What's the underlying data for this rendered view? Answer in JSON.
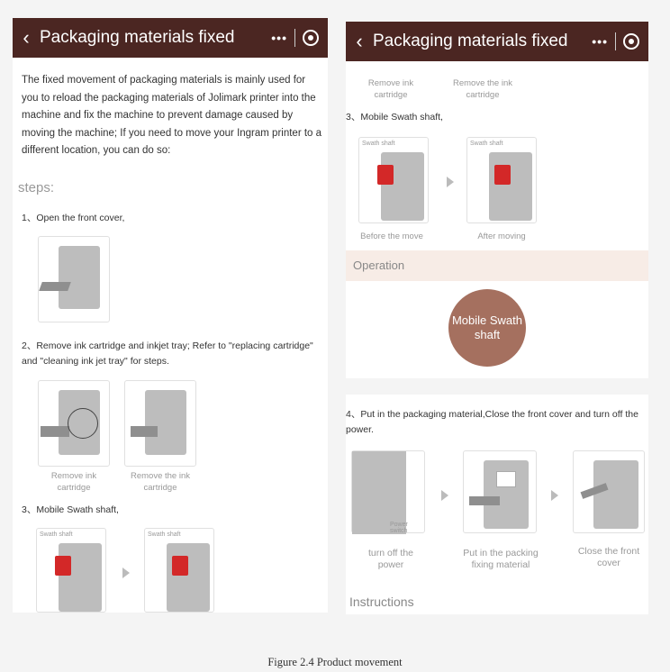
{
  "app": {
    "title": "Packaging materials fixed",
    "back_icon": "chevron-left-icon",
    "more_icon": "more-dots-icon",
    "close_icon": "target-icon"
  },
  "left": {
    "intro": "The fixed movement of packaging materials is mainly used for you to reload the packaging materials of Jolimark printer into the machine and fix the machine to prevent damage caused by moving the machine; If you need to move your Ingram printer to a different location, you can do so:",
    "steps_heading": "steps:",
    "step1": "1、Open the front cover,",
    "step2": "2、Remove ink cartridge and inkjet tray; Refer to \"replacing cartridge\" and \"cleaning ink jet tray\" for steps.",
    "step2_caption_a": "Remove ink cartridge",
    "step2_caption_b": "Remove the ink cartridge",
    "step3": "3、Mobile Swath shaft,",
    "swath_tag": "Swath shaft"
  },
  "right_top": {
    "caption_a": "Remove ink cartridge",
    "caption_b": "Remove the ink cartridge",
    "step3": "3、Mobile Swath shaft,",
    "swath_tag": "Swath shaft",
    "before": "Before the move",
    "after": "After moving",
    "operation": "Operation",
    "button": "Mobile Swath shaft"
  },
  "right_bottom": {
    "step4": "4、Put in the packaging material,Close the front cover and turn off the power.",
    "cap1": "turn off the power",
    "cap2": "Put in the packing fixing material",
    "cap3": "Close the front cover",
    "power_tag": "Power switch",
    "instructions": "Instructions"
  },
  "figure_caption": "Figure 2.4  Product movement",
  "colors": {
    "header_bg": "#4b2622",
    "operation_bg": "#f7ece6",
    "button_bg": "#a5705f",
    "swath_red": "#d32828"
  }
}
